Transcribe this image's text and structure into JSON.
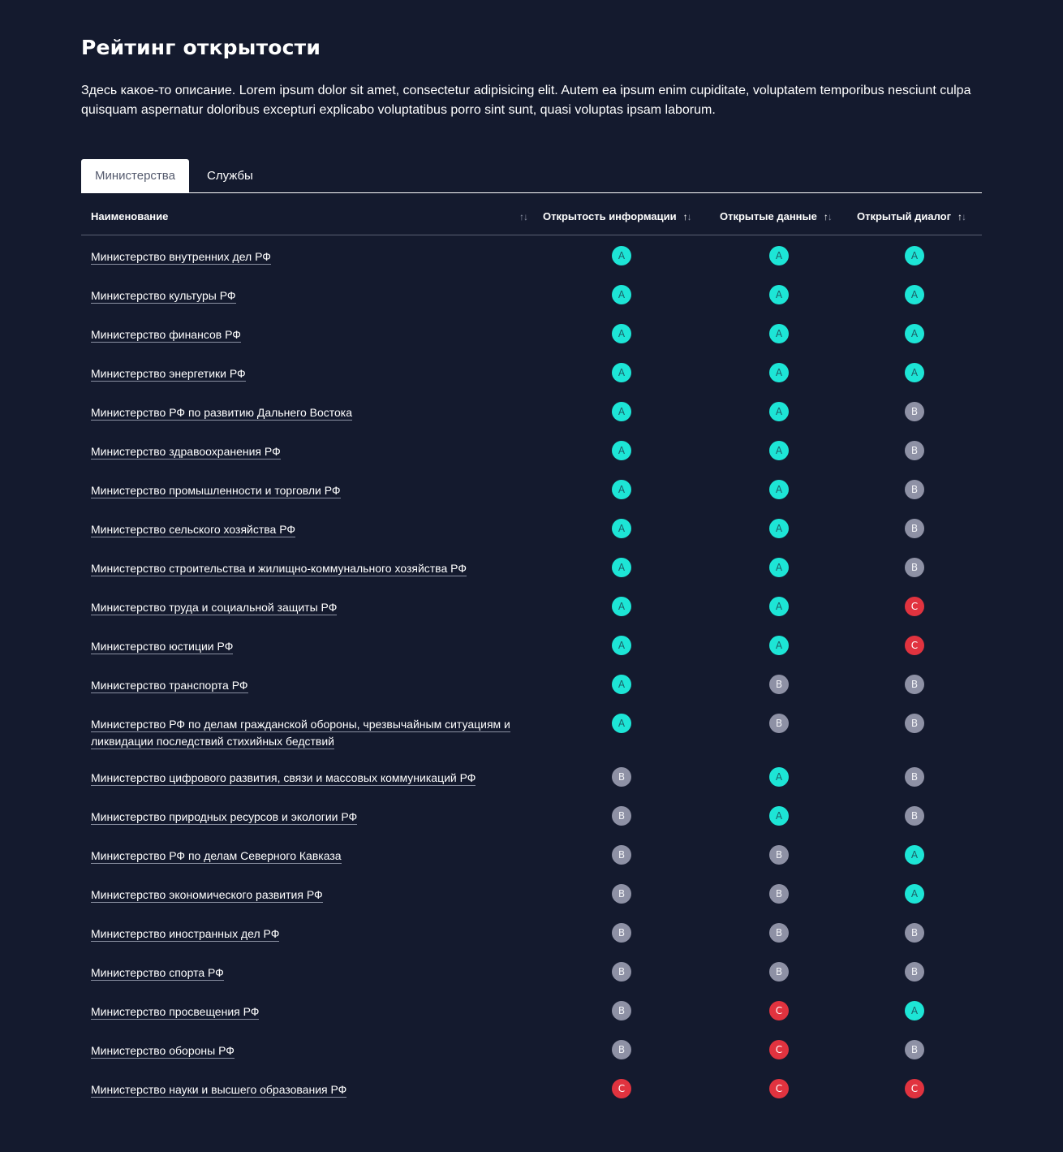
{
  "page": {
    "title": "Рейтинг открытости",
    "description": "Здесь какое-то описание. Lorem ipsum dolor sit amet, consectetur adipisicing elit. Autem ea ipsum enim cupiditate, voluptatem temporibus nesciunt culpa quisquam aspernatur doloribus excepturi explicabo voluptatibus porro sint sunt, quasi voluptas ipsam laborum."
  },
  "tabs": [
    {
      "label": "Министерства",
      "active": true
    },
    {
      "label": "Службы",
      "active": false
    }
  ],
  "columns": [
    {
      "label": "Наименование",
      "sort": "none"
    },
    {
      "label": "Открытость информации",
      "sort": "asc"
    },
    {
      "label": "Открытые данные",
      "sort": "asc"
    },
    {
      "label": "Открытый диалог",
      "sort": "asc"
    }
  ],
  "rows": [
    {
      "name": "Министерство внутренних дел РФ",
      "info": "A",
      "data": "A",
      "dialog": "A"
    },
    {
      "name": "Министерство культуры РФ",
      "info": "A",
      "data": "A",
      "dialog": "A"
    },
    {
      "name": "Министерство финансов РФ",
      "info": "A",
      "data": "A",
      "dialog": "A"
    },
    {
      "name": "Министерство энергетики РФ",
      "info": "A",
      "data": "A",
      "dialog": "A"
    },
    {
      "name": "Министерство РФ по развитию Дальнего Востока",
      "info": "A",
      "data": "A",
      "dialog": "B"
    },
    {
      "name": "Министерство здравоохранения РФ",
      "info": "A",
      "data": "A",
      "dialog": "B"
    },
    {
      "name": "Министерство промышленности и торговли РФ",
      "info": "A",
      "data": "A",
      "dialog": "B"
    },
    {
      "name": "Министерство сельского хозяйства РФ",
      "info": "A",
      "data": "A",
      "dialog": "B"
    },
    {
      "name": "Министерство строительства и жилищно-коммунального хозяйства РФ",
      "info": "A",
      "data": "A",
      "dialog": "B"
    },
    {
      "name": "Министерство труда и социальной защиты РФ",
      "info": "A",
      "data": "A",
      "dialog": "C"
    },
    {
      "name": "Министерство юстиции РФ",
      "info": "A",
      "data": "A",
      "dialog": "C"
    },
    {
      "name": "Министерство транспорта РФ",
      "info": "A",
      "data": "B",
      "dialog": "B"
    },
    {
      "name": "Министерство РФ по делам гражданской обороны, чрезвычайным ситуациям и ликвидации последствий стихийных бедствий",
      "info": "A",
      "data": "B",
      "dialog": "B"
    },
    {
      "name": "Министерство цифрового развития, связи и массовых коммуникаций РФ",
      "info": "B",
      "data": "A",
      "dialog": "B"
    },
    {
      "name": "Министерство природных ресурсов и экологии РФ",
      "info": "B",
      "data": "A",
      "dialog": "B"
    },
    {
      "name": "Министерство РФ по делам Северного Кавказа",
      "info": "B",
      "data": "B",
      "dialog": "A"
    },
    {
      "name": "Министерство экономического развития РФ",
      "info": "B",
      "data": "B",
      "dialog": "A"
    },
    {
      "name": "Министерство иностранных дел РФ",
      "info": "B",
      "data": "B",
      "dialog": "B"
    },
    {
      "name": "Министерство спорта РФ",
      "info": "B",
      "data": "B",
      "dialog": "B"
    },
    {
      "name": "Министерство просвещения РФ",
      "info": "B",
      "data": "C",
      "dialog": "A"
    },
    {
      "name": "Министерство обороны РФ",
      "info": "B",
      "data": "C",
      "dialog": "B"
    },
    {
      "name": "Министерство науки и высшего образования РФ",
      "info": "C",
      "data": "C",
      "dialog": "C"
    }
  ],
  "colors": {
    "background": "#141a2e",
    "grade_A": "#1de5d6",
    "grade_B": "#8e91a5",
    "grade_C": "#e1333f"
  }
}
